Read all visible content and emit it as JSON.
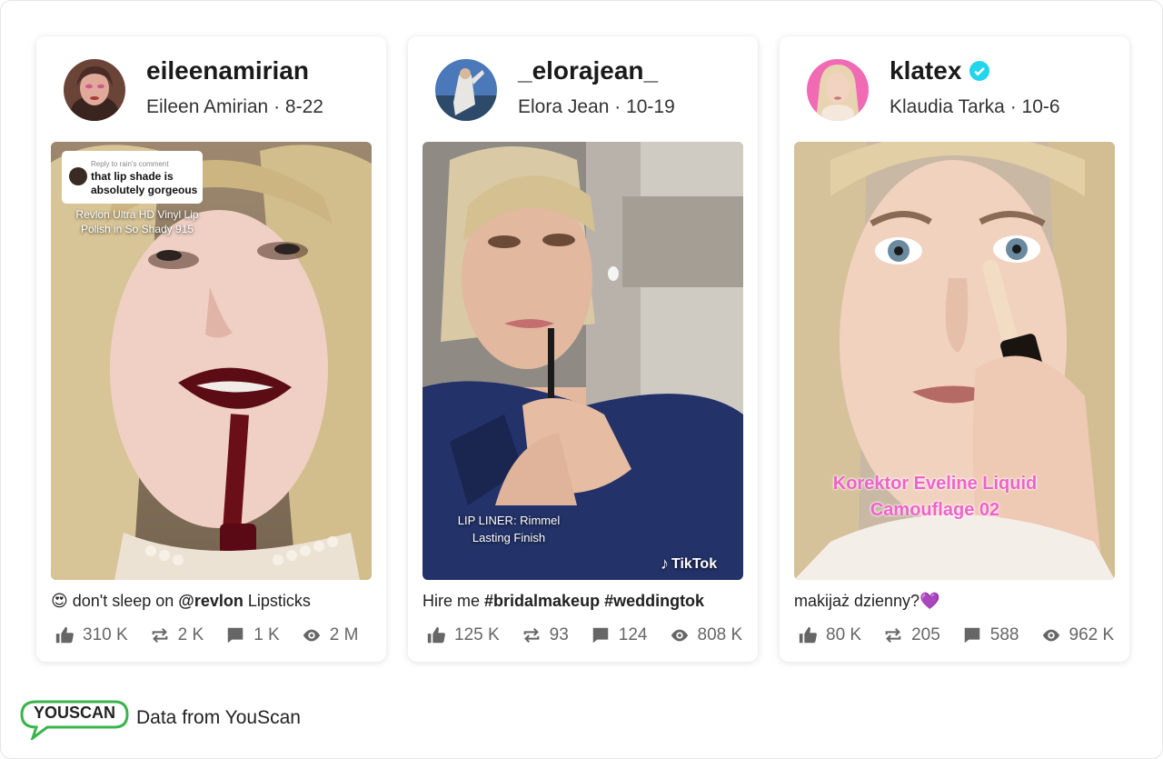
{
  "posts": [
    {
      "handle": "eileenamirian",
      "name": "Eileen Amirian",
      "date": "8-22",
      "overlay": {
        "reply_label": "Reply to rain's comment",
        "reply_text": "that lip shade is absolutely gorgeous",
        "product_text": "Revlon Ultra HD Vinyl Lip Polish in So Shady 915"
      },
      "caption_emoji": "😍",
      "caption_text": " don't sleep on ",
      "caption_bold": "@revlon",
      "caption_tail": " Lipsticks",
      "likes": "310 K",
      "shares": "2 K",
      "comments": "1 K",
      "views": "2 M"
    },
    {
      "handle": "_elorajean_",
      "name": "Elora Jean",
      "date": "10-19",
      "overlay": {
        "product_text": "LIP LINER: Rimmel Lasting Finish",
        "watermark": "TikTok"
      },
      "caption_text": "Hire me ",
      "caption_bold": "#bridalmakeup #weddingtok",
      "caption_tail": "",
      "likes": "125 K",
      "shares": "93",
      "comments": "124",
      "views": "808 K"
    },
    {
      "handle": "klatex",
      "name": "Klaudia Tarka",
      "date": "10-6",
      "verified": true,
      "overlay": {
        "product_text": "Korektor Eveline Liquid Camouflage 02"
      },
      "caption_text": "makijaż dzienny?💜",
      "caption_bold": "",
      "caption_tail": "",
      "likes": "80 K",
      "shares": "205",
      "comments": "588",
      "views": "962 K"
    }
  ],
  "footer": {
    "logo_text": "YOUSCAN",
    "text": "Data from YouScan"
  },
  "colors": {
    "verified": "#20d5ec",
    "overlay_pink": "#f062c8",
    "stat_gray": "#666666"
  }
}
